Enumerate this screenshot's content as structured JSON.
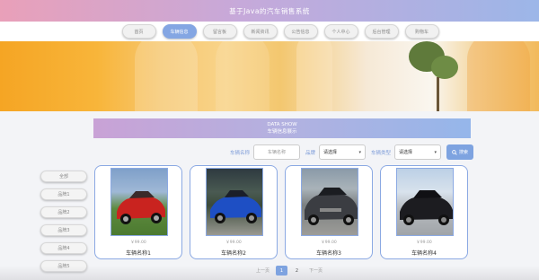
{
  "header": {
    "title": "基于Java的汽车销售系统"
  },
  "nav": {
    "items": [
      {
        "label": "首页",
        "active": false
      },
      {
        "label": "车辆信息",
        "active": true
      },
      {
        "label": "留言板",
        "active": false
      },
      {
        "label": "新闻资讯",
        "active": false
      },
      {
        "label": "公告信息",
        "active": false
      },
      {
        "label": "个人中心",
        "active": false
      },
      {
        "label": "后台管理",
        "active": false
      },
      {
        "label": "购物车",
        "active": false
      }
    ]
  },
  "section": {
    "title_en": "DATA SHOW",
    "title_cn": "车辆信息展示"
  },
  "filters": {
    "name_label": "车辆名称",
    "name_placeholder": "车辆名称",
    "brand_label": "品牌",
    "brand_value": "请选择",
    "type_label": "车辆类型",
    "type_value": "请选择",
    "search_label": "搜索"
  },
  "sidebar": {
    "items": [
      "全部",
      "品牌1",
      "品牌2",
      "品牌3",
      "品牌4",
      "品牌5"
    ]
  },
  "cards": [
    {
      "price": "￥99.00",
      "name": "车辆名称1",
      "car_color": "#c9231f"
    },
    {
      "price": "￥99.00",
      "name": "车辆名称2",
      "car_color": "#1e4fc4"
    },
    {
      "price": "￥99.00",
      "name": "车辆名称3",
      "car_color": "#3b3d42"
    },
    {
      "price": "￥99.00",
      "name": "车辆名称4",
      "car_color": "#1c1c20"
    }
  ],
  "pager": {
    "prev": "上一页",
    "pages": [
      "1",
      "2"
    ],
    "current": "1",
    "next": "下一页"
  },
  "colors": {
    "accent": "#7ea3e0",
    "header_start": "#e9a0b9",
    "header_end": "#9cb6e8"
  }
}
